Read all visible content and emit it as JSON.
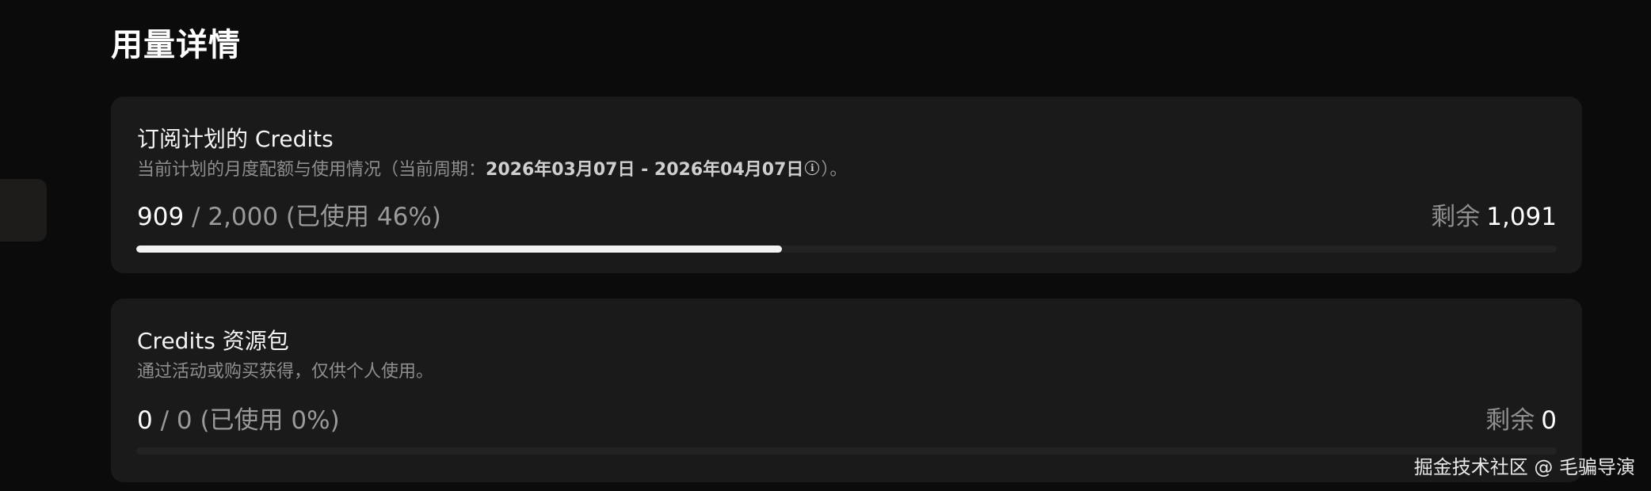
{
  "page": {
    "title": "用量详情"
  },
  "subscription_credits": {
    "title": "订阅计划的 Credits",
    "description_prefix": "当前计划的月度配额与使用情况（当前周期：",
    "period": "2026年03月07日 - 2026年04月07日",
    "description_suffix": "）。",
    "info_icon": "info-icon",
    "used": "909",
    "total": " / 2,000 (已使用 46%)",
    "remaining_label": "剩余",
    "remaining_value": "1,091",
    "progress_fraction": 0.4545
  },
  "credit_packs": {
    "title": "Credits 资源包",
    "description": "通过活动或购买获得，仅供个人使用。",
    "used": "0",
    "total": " / 0 (已使用 0%)",
    "remaining_label": "剩余",
    "remaining_value": "0",
    "progress_fraction": 0
  },
  "watermark": "掘金技术社区 @ 毛骗导演"
}
